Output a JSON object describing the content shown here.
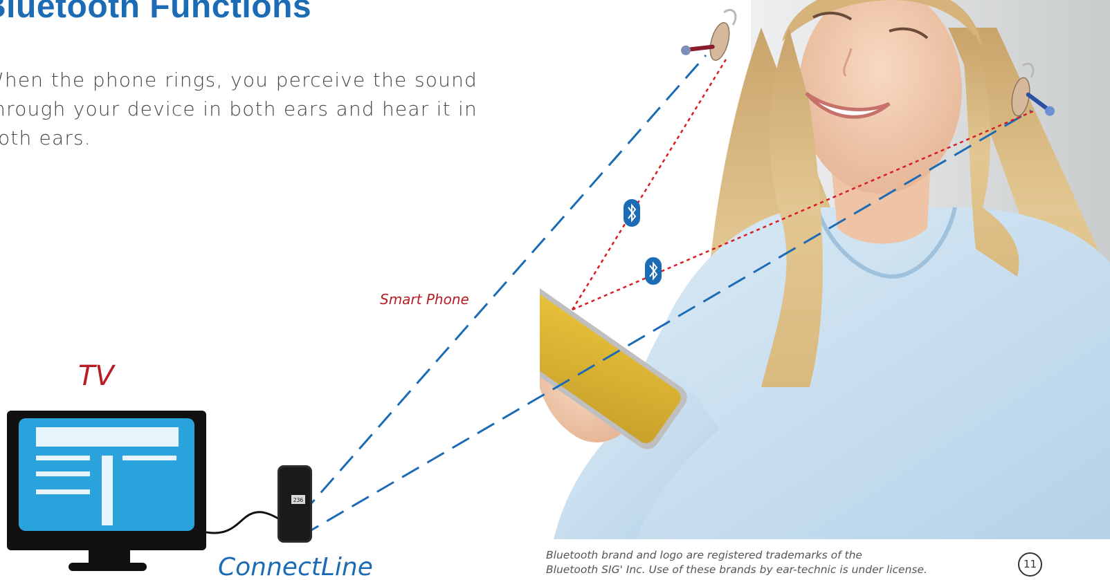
{
  "heading": {
    "title": "Bluetooth Functions"
  },
  "intro": {
    "text": "When the phone rings, you perceive the sound through your device in both ears and hear it in both ears."
  },
  "diagram": {
    "smart_phone_label": "Smart Phone",
    "tv_label": "TV",
    "connectline_label": "ConnectLine",
    "connectline_display": "236",
    "bluetooth_icon_name": "bluetooth-icon",
    "colors": {
      "title_blue": "#1b6bb5",
      "label_red": "#b71c23",
      "bluetooth_link": "#d91c24",
      "connectline_link": "#1b6bb5",
      "tv_screen": "#2aa3dc",
      "tv_frame": "#111111"
    }
  },
  "footer": {
    "trademark_line1": "Bluetooth brand and logo are registered trademarks of the",
    "trademark_line2": "Bluetooth SIG' Inc. Use of these brands by ear-technic is under license.",
    "page_number": "11"
  }
}
